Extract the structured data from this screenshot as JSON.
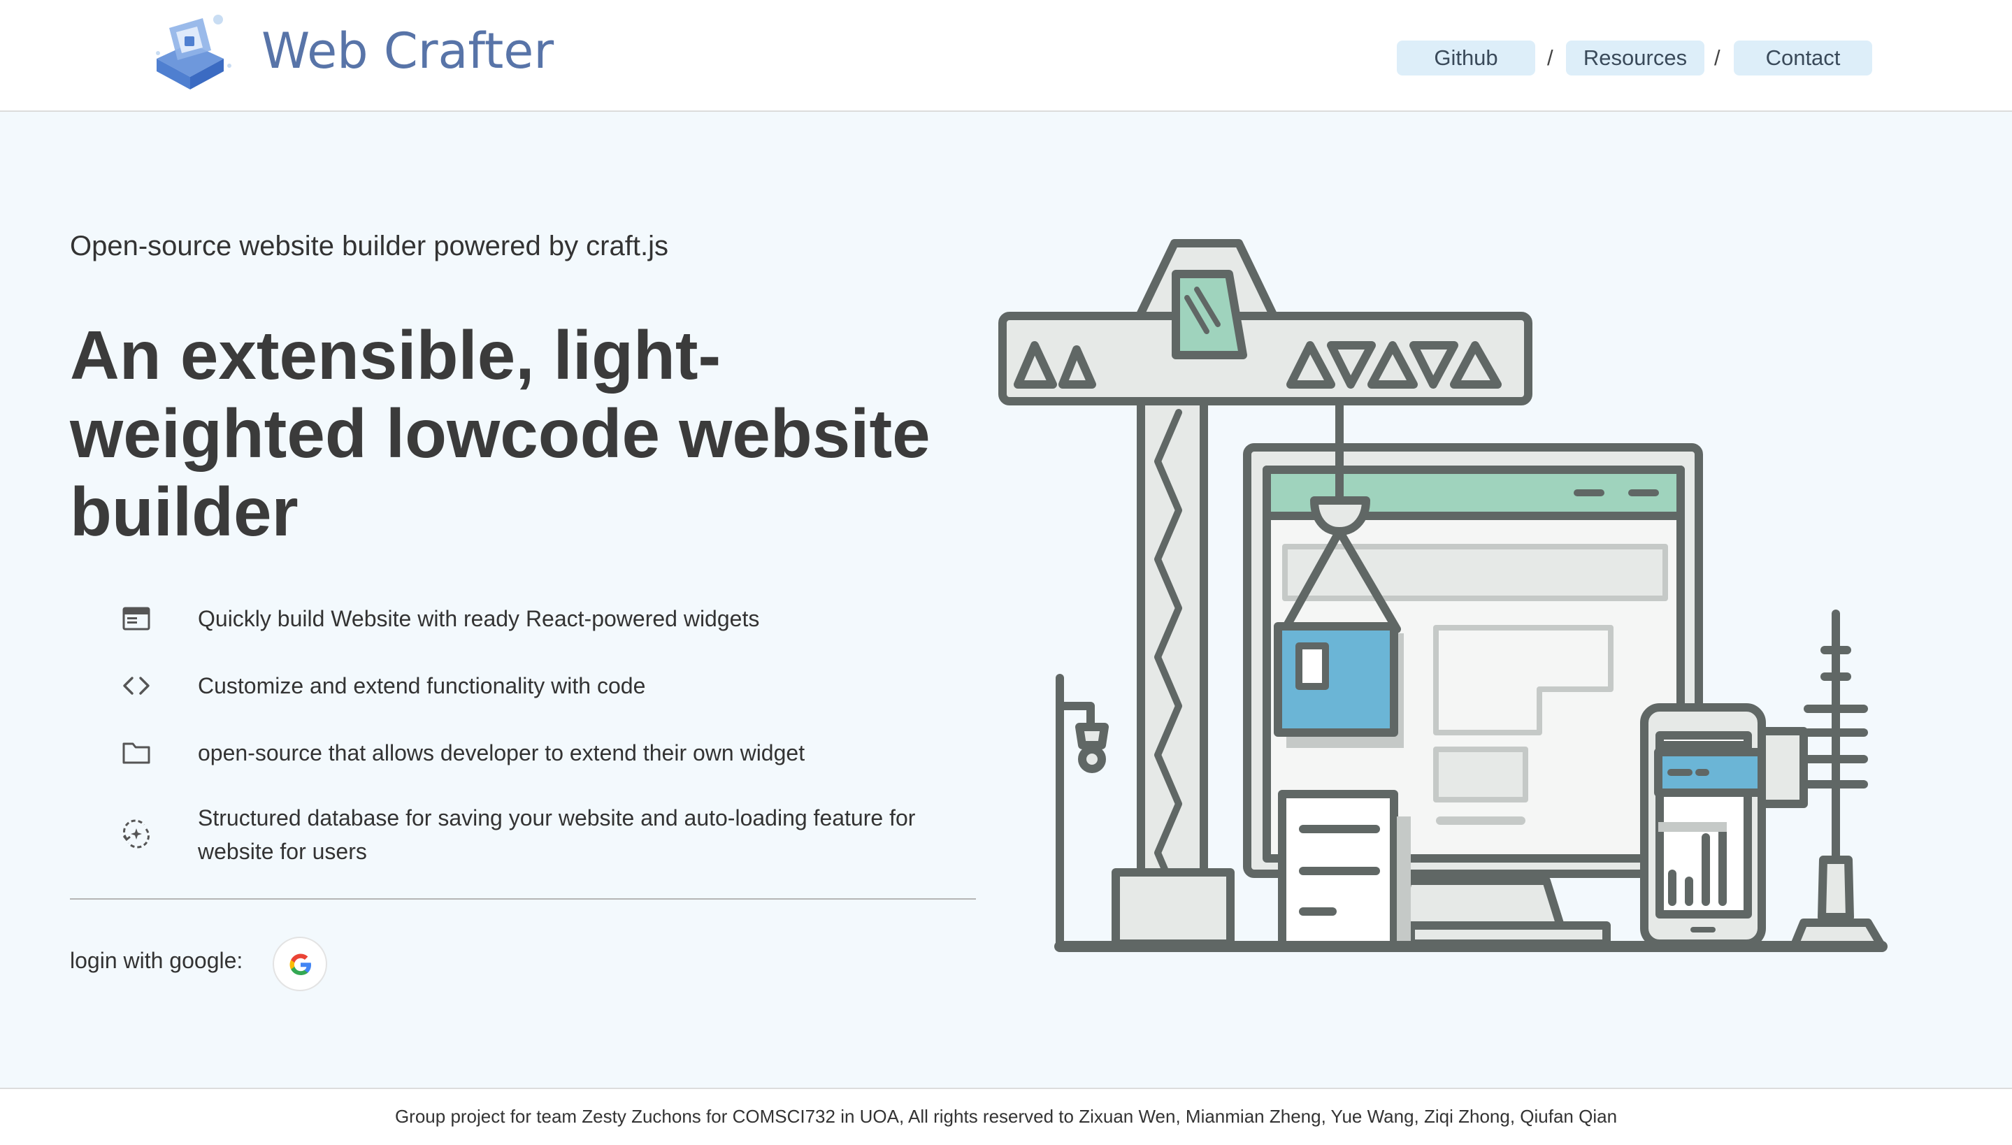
{
  "header": {
    "brand": "Web Crafter",
    "nav": [
      {
        "label": "Github"
      },
      {
        "label": "Resources"
      },
      {
        "label": "Contact"
      }
    ],
    "separator": "/"
  },
  "hero": {
    "subtitle": "Open-source website builder powered by craft.js",
    "headline": "An extensible, light-weighted lowcode website builder",
    "features": [
      {
        "icon": "window-icon",
        "text": "Quickly build Website with ready React-powered widgets"
      },
      {
        "icon": "code-icon",
        "text": "Customize and extend functionality with code"
      },
      {
        "icon": "folder-icon",
        "text": "open-source that allows developer to extend their own widget"
      },
      {
        "icon": "sync-sparkle-icon",
        "text": "Structured database for saving your website and auto-loading feature for website for users"
      }
    ],
    "login_label": "login with google:"
  },
  "footer": {
    "text": "Group project for team Zesty Zuchons for COMSCI732 in UOA, All rights reserved to Zixuan Wen, Mianmian Zheng, Yue Wang, Ziqi Zhong, Qiufan Qian"
  },
  "colors": {
    "brand": "#5874a8",
    "nav_bg": "#ddeef9",
    "page_bg": "#f3f9fd",
    "illustration_green": "#9fd3bd",
    "illustration_blue": "#6bb5d6",
    "illustration_stroke": "#606765"
  }
}
